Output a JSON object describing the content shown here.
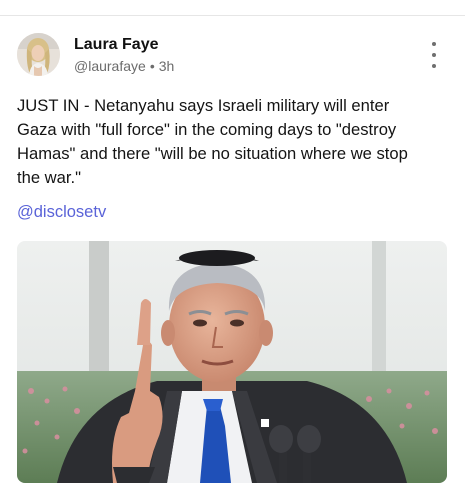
{
  "post": {
    "author": {
      "name": "Laura Faye",
      "handle": "@laurafaye",
      "separator": "•",
      "time": "3h"
    },
    "text_lines": [
      "JUST IN - Netanyahu says Israeli military will enter",
      "Gaza with \"full force\" in the coming days to \"destroy",
      "Hamas\" and there \"will be no situation where we stop",
      "the war.\""
    ],
    "mention": "@disclosetv"
  },
  "icons": {
    "more": "more-vertical-icon"
  },
  "colors": {
    "mention": "#5a63d8",
    "name": "#111111",
    "meta": "#6c6c6c",
    "body_text": "#141414",
    "divider": "#e6e6e6"
  }
}
